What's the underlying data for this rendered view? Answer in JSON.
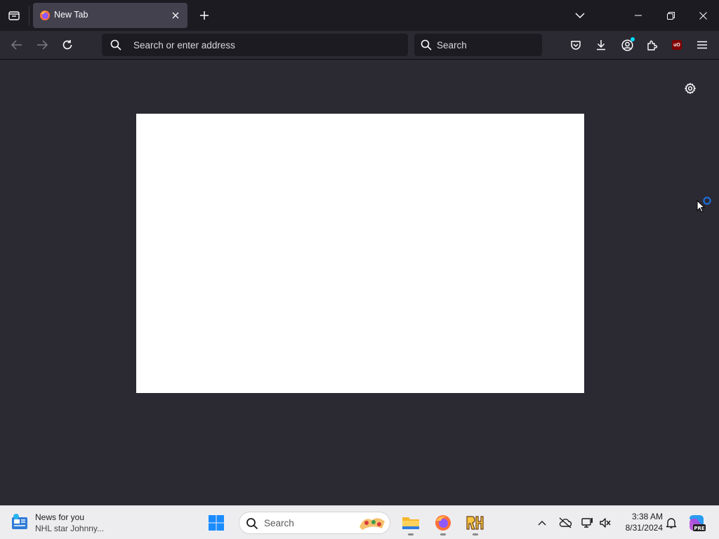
{
  "browser": {
    "tab": {
      "title": "New Tab",
      "favicon": "firefox-icon"
    },
    "urlbar": {
      "placeholder": "Search or enter address"
    },
    "searchbar": {
      "placeholder": "Search"
    },
    "toolbar_icons": [
      "pocket-icon",
      "download-icon",
      "account-icon",
      "extensions-icon",
      "ublock-icon",
      "menu-icon"
    ],
    "ublock_badge": "uO",
    "accent_color": "#00ddff"
  },
  "content": {
    "settings_icon": "gear-icon",
    "panel_color": "#ffffff"
  },
  "taskbar": {
    "news": {
      "title": "News for you",
      "headline": "NHL star Johnny..."
    },
    "search_placeholder": "Search",
    "apps": [
      "file-explorer-icon",
      "firefox-icon",
      "rh-app-icon"
    ],
    "clock": {
      "time": "3:38 AM",
      "date": "8/31/2024"
    },
    "copilot_badge": "PRE"
  },
  "colors": {
    "titlebar": "#1c1b22",
    "toolbar": "#2b2a33",
    "tab_active": "#42414d",
    "taskbar": "#ededf0"
  }
}
